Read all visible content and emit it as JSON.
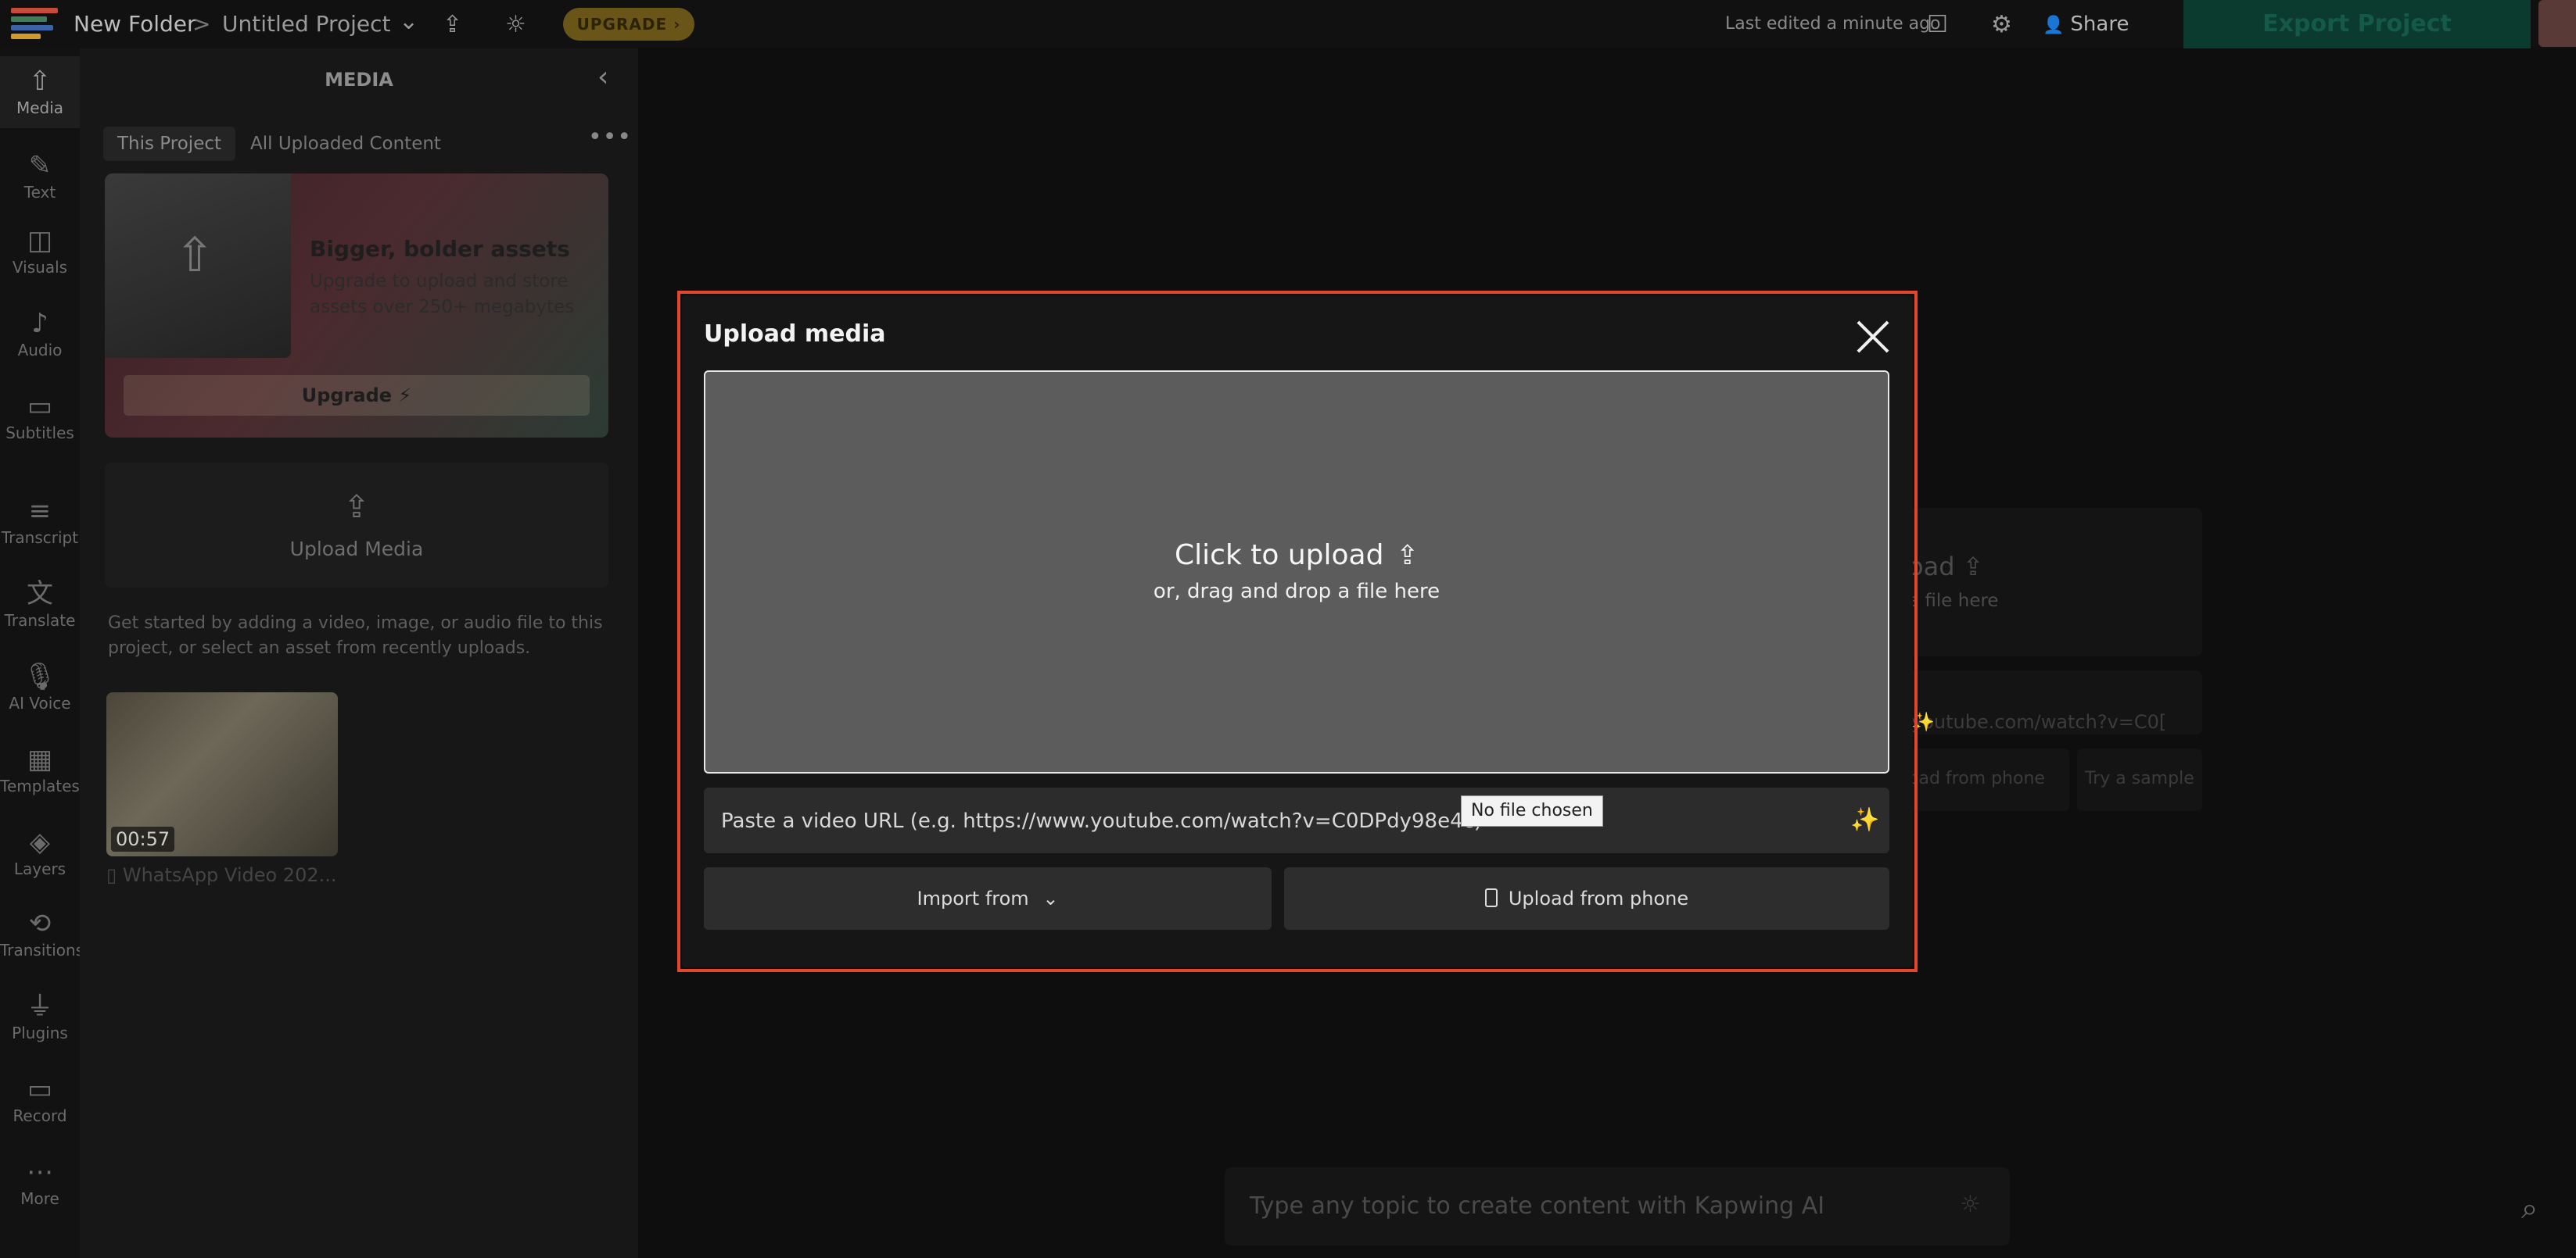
{
  "topbar": {
    "folder": "New Folder",
    "separator": ">",
    "project_title": "Untitled Project",
    "upgrade_label": "UPGRADE",
    "last_edited": "Last edited a minute ago",
    "share_label": "Share",
    "export_label": "Export Project"
  },
  "rail": {
    "items": [
      {
        "label": "Media",
        "icon": "upload-icon"
      },
      {
        "label": "Text",
        "icon": "edit-icon"
      },
      {
        "label": "Visuals",
        "icon": "shapes-icon"
      },
      {
        "label": "Audio",
        "icon": "music-note-icon"
      },
      {
        "label": "Subtitles",
        "icon": "caption-icon"
      },
      {
        "label": "Transcript",
        "icon": "transcript-icon"
      },
      {
        "label": "Translate",
        "icon": "translate-icon"
      },
      {
        "label": "AI Voice",
        "icon": "microphone-icon"
      },
      {
        "label": "Templates",
        "icon": "templates-icon"
      },
      {
        "label": "Layers",
        "icon": "layers-icon"
      },
      {
        "label": "Transitions",
        "icon": "transitions-icon"
      },
      {
        "label": "Plugins",
        "icon": "plug-icon"
      },
      {
        "label": "Record",
        "icon": "camera-icon"
      },
      {
        "label": "More",
        "icon": "more-dots-icon"
      }
    ]
  },
  "panel": {
    "title": "MEDIA",
    "tabs": [
      "This Project",
      "All Uploaded Content"
    ],
    "promo": {
      "title": "Bigger, bolder assets",
      "subtitle": "Upgrade to upload and store assets over 250+ megabytes",
      "button": "Upgrade"
    },
    "upload_label": "Upload Media",
    "hint": "Get started by adding a video, image, or audio file to this project, or select an asset from recently uploads.",
    "asset": {
      "duration": "00:57",
      "name": "WhatsApp Video 202..."
    }
  },
  "background": {
    "click_upload": "oad",
    "drag_text": "a file here",
    "url_text": "youtube.com/watch?v=C0[",
    "phone_text": "oad from phone",
    "sample_text": "Try a sample",
    "ai_placeholder": "Type any topic to create content with Kapwing AI"
  },
  "modal": {
    "title": "Upload media",
    "click_to_upload": "Click to upload",
    "drag_drop": "or, drag and drop a file here",
    "url_placeholder": "Paste a video URL (e.g. https://www.youtube.com/watch?v=C0DPdy98e4c)",
    "tooltip": "No file chosen",
    "import_label": "Import from",
    "phone_label": "Upload from phone"
  },
  "colors": {
    "highlight": "#e5452b",
    "export": "#0b3a2e",
    "upgrade": "#6a5518"
  }
}
